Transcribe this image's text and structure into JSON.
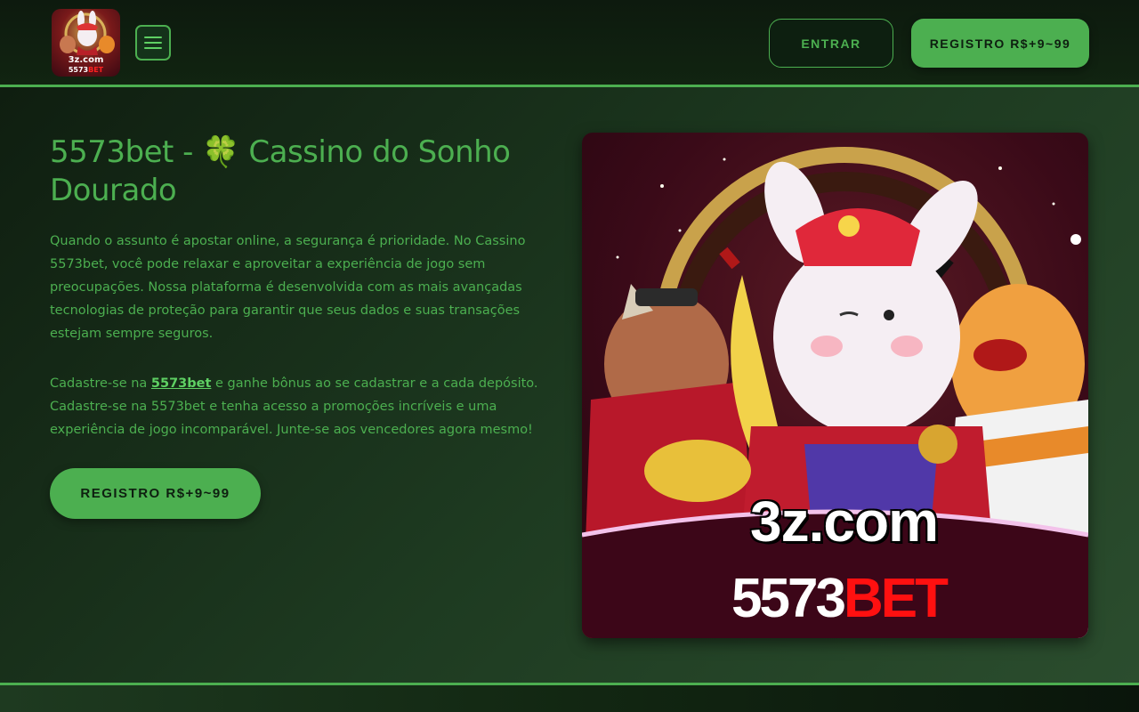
{
  "header": {
    "logo": {
      "line1": "3z.com",
      "line2_white": "5573",
      "line2_red": "BET"
    },
    "menu_icon": "hamburger-menu-icon",
    "login_label": "ENTRAR",
    "register_label": "REGISTRO R$+9~99"
  },
  "main": {
    "title": "5573bet - 🍀 Cassino do Sonho Dourado",
    "paragraph1": "Quando o assunto é apostar online, a segurança é prioridade. No Cassino 5573bet, você pode relaxar e aproveitar a experiência de jogo sem preocupações. Nossa plataforma é desenvolvida com as mais avançadas tecnologias de proteção para garantir que seus dados e suas transações estejam sempre seguros.",
    "paragraph2": {
      "prefix": "Cadastre-se na ",
      "link": "5573bet",
      "suffix": " e ganhe bônus ao se cadastrar e a cada depósito. Cadastre-se na 5573bet e tenha acesso a promoções incríveis e uma experiência de jogo incomparável. Junte-se aos vencedores agora mesmo!"
    },
    "cta_label": "REGISTRO R$+9~99"
  },
  "hero": {
    "caption1": "3z.com",
    "caption2_white": "5573",
    "caption2_red": "BET"
  },
  "colors": {
    "accent": "#4caf50",
    "background": "#0f1d10",
    "brand_red": "#ff1010"
  }
}
